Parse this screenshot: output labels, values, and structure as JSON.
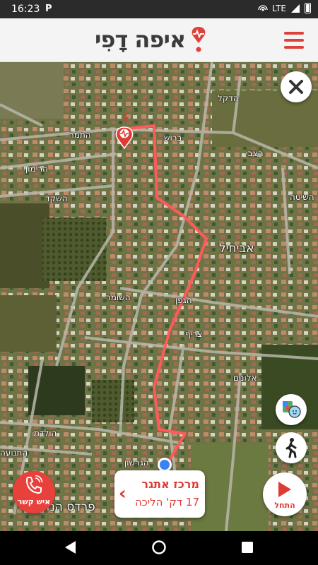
{
  "status_bar": {
    "time": "16:23",
    "app_badge": "P",
    "network": "LTE"
  },
  "header": {
    "logo_text": "איפה דָפִי",
    "menu_icon": "hamburger-menu-icon"
  },
  "map": {
    "street_labels": [
      "הדקל",
      "ברוש",
      "הצבי",
      "התמר",
      "הרימון",
      "השקד",
      "השיטה",
      "אביחיל",
      "הרנבה",
      "השומר",
      "הגפן",
      "צריף",
      "אלונים",
      "הולדת",
      "התנועה",
      "הגרשון",
      "פרדס הנדיב"
    ],
    "close_icon": "close-icon",
    "waze_icon": "waze-icon",
    "walk_icon": "pedestrian-icon",
    "destination_marker_icon": "heart-pulse-marker-icon"
  },
  "call_button": {
    "label": "איש קשר",
    "icon": "phone-icon"
  },
  "destination_card": {
    "name": "מרכז אתגר",
    "eta": "17 דק' הליכה"
  },
  "start_button": {
    "label": "התחל",
    "icon": "play-icon"
  },
  "colors": {
    "accent": "#e03a35",
    "route": "#ff5a5a",
    "location": "#3b82f6"
  }
}
